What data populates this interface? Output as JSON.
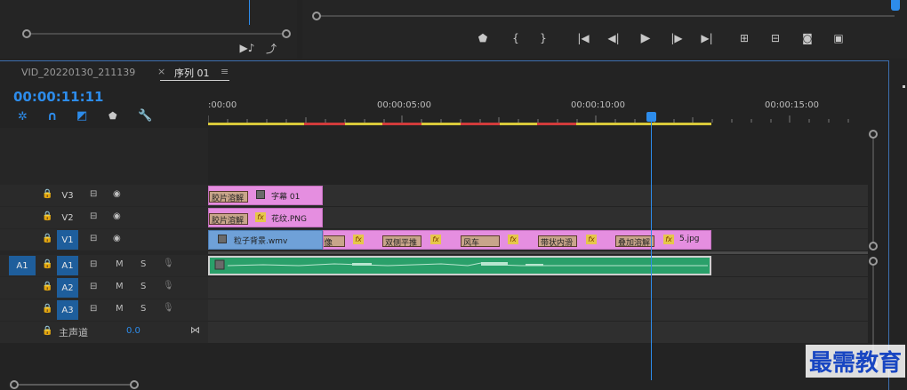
{
  "source_panel": {
    "buttons": [
      "insert-icon",
      "export-frame-icon"
    ]
  },
  "program_panel": {
    "transport": [
      "marker-icon",
      "mark-in-icon",
      "mark-out-icon",
      "go-to-in-icon",
      "step-back-icon",
      "play-icon",
      "step-forward-icon",
      "go-to-out-icon",
      "lift-icon",
      "extract-icon",
      "camera-icon",
      "multi-camera-icon"
    ]
  },
  "timeline": {
    "tabs": [
      {
        "label": "VID_20220130_211139",
        "active": false
      },
      {
        "label": "序列 01",
        "active": true
      }
    ],
    "close_glyph": "×",
    "menu_glyph": "≡",
    "timecode": "00:00:11:11",
    "ruler": [
      ":00:00",
      "00:00:05:00",
      "00:00:10:00",
      "00:00:15:00"
    ],
    "tracks": {
      "v3": "V3",
      "v2": "V2",
      "v1": "V1",
      "a1": "A1",
      "a2": "A2",
      "a3": "A3",
      "source_a1": "A1",
      "m": "M",
      "s": "S",
      "master_label": "主声道",
      "master_value": "0.0"
    },
    "clips": {
      "v3_clip1": "胶片溶解",
      "v3_clip2": "字幕 01",
      "v2_clip1": "胶片溶解",
      "v2_clip2": "花纹.PNG",
      "v1_clip1": "粒子背景.wmv",
      "v1_trans1": "圆划像",
      "v1_trans2": "双侧平推",
      "v1_trans3": "风车",
      "v1_trans4": "带状内滑",
      "v1_trans5": "叠加溶解",
      "v1_last": "5.jpg",
      "fx": "fx"
    }
  },
  "watermark": "最需教育",
  "colors": {
    "accent": "#2d8ceb",
    "clip_pink": "#e58ee0",
    "clip_blue": "#6fa1d8",
    "audio": "#2aa06a"
  }
}
